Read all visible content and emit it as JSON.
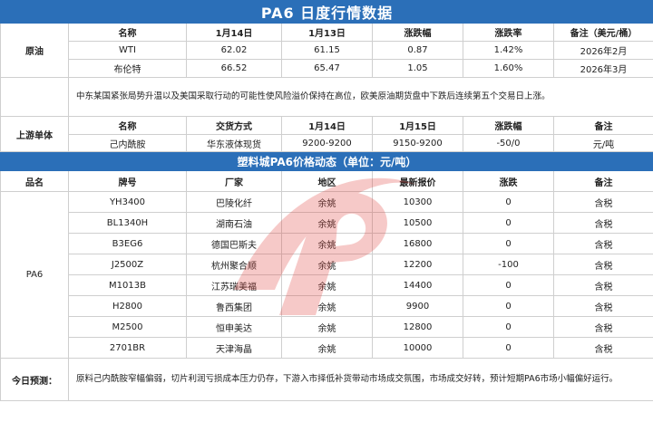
{
  "title": "PA6 日度行情数据",
  "crude": {
    "section_label": "原油",
    "headers": [
      "名称",
      "1月14日",
      "1月13日",
      "涨跌幅",
      "涨跌率",
      "备注（美元/桶）"
    ],
    "rows": [
      [
        "WTI",
        "62.02",
        "61.15",
        "0.87",
        "1.42%",
        "2026年2月"
      ],
      [
        "布伦特",
        "66.52",
        "65.47",
        "1.05",
        "1.60%",
        "2026年3月"
      ]
    ],
    "note": "中东某国紧张局势升温以及美国采取行动的可能性使风险溢价保持在高位，欧美原油期货盘中下跌后连续第五个交易日上涨。"
  },
  "upstream": {
    "section_label": "上游单体",
    "headers": [
      "名称",
      "交货方式",
      "1月14日",
      "1月15日",
      "涨跌幅",
      "备注"
    ],
    "row": [
      "己内酰胺",
      "华东液体现货",
      "9200-9200",
      "9150-9200",
      "-50/0",
      "元/吨"
    ]
  },
  "dynamics": {
    "title": "塑料城PA6价格动态（单位：元/吨）",
    "headers": [
      "品名",
      "牌号",
      "厂家",
      "地区",
      "最新报价",
      "涨跌",
      "备注"
    ],
    "product": "PA6",
    "rows": [
      [
        "YH3400",
        "巴陵化纤",
        "余姚",
        "10300",
        "0",
        "含税"
      ],
      [
        "BL1340H",
        "湖南石油",
        "余姚",
        "10500",
        "0",
        "含税"
      ],
      [
        "B3EG6",
        "德国巴斯夫",
        "余姚",
        "16800",
        "0",
        "含税"
      ],
      [
        "J2500Z",
        "杭州聚合顺",
        "余姚",
        "12200",
        "-100",
        "含税"
      ],
      [
        "M1013B",
        "江苏瑞美福",
        "余姚",
        "14400",
        "0",
        "含税"
      ],
      [
        "H2800",
        "鲁西集团",
        "余姚",
        "9900",
        "0",
        "含税"
      ],
      [
        "M2500",
        "恒申美达",
        "余姚",
        "12800",
        "0",
        "含税"
      ],
      [
        "2701BR",
        "天津海晶",
        "余姚",
        "10000",
        "0",
        "含税"
      ]
    ]
  },
  "forecast": {
    "label": "今日预测：",
    "text": "原料己内酰胺窄幅偏弱，切片利润亏损成本压力仍存，下游入市择低补货带动市场成交氛围，市场成交好转，预计短期PA6市场小幅偏好运行。"
  },
  "colors": {
    "header_bar": "#2b6fb8",
    "watermark": "#e0423c"
  }
}
